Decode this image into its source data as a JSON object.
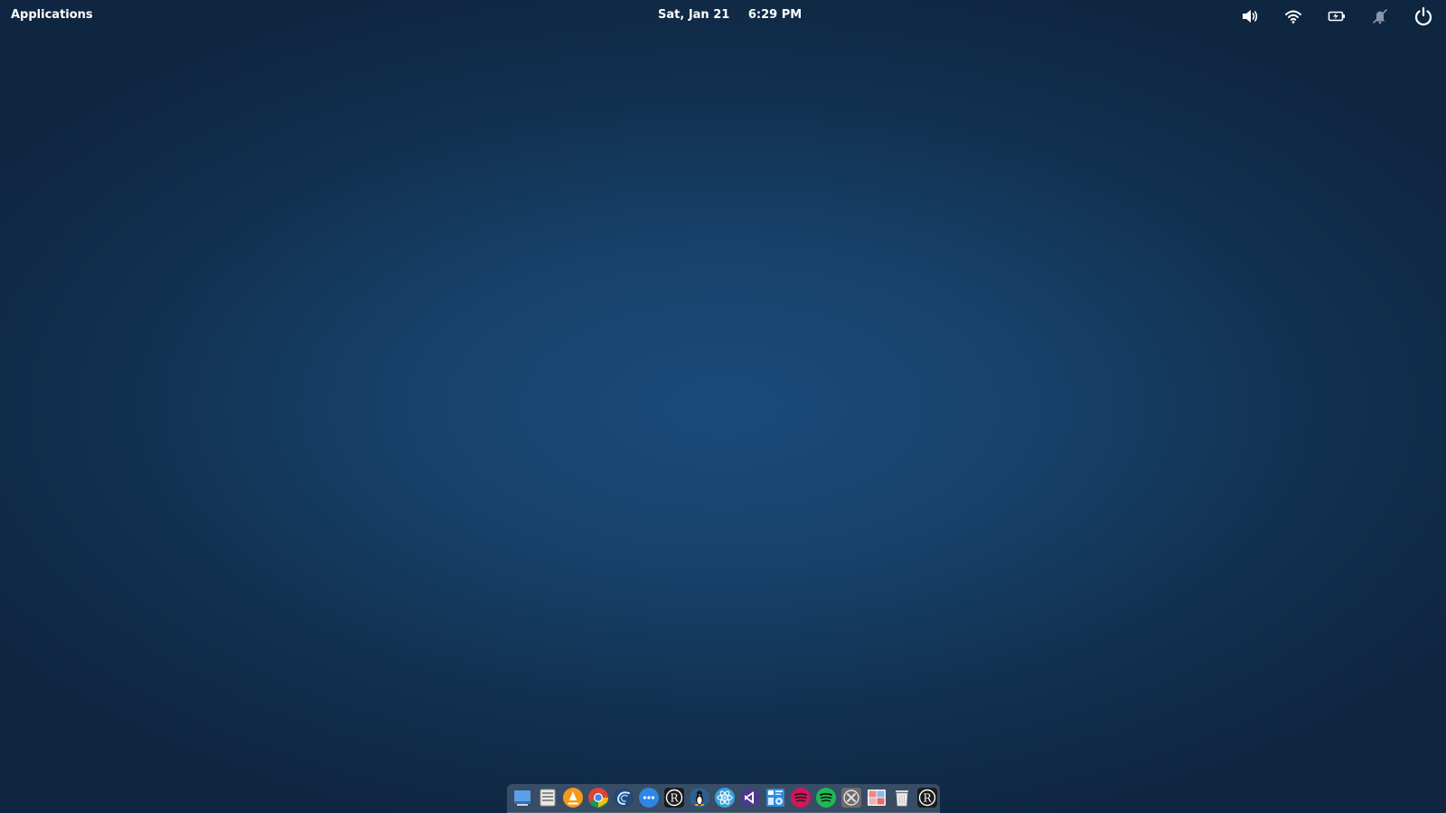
{
  "top_panel": {
    "applications_label": "Applications",
    "date": "Sat, Jan 21",
    "time": "6:29 PM",
    "tray": [
      "volume-icon",
      "wifi-icon",
      "battery-icon",
      "notifications-disabled-icon",
      "power-icon"
    ]
  },
  "colors": {
    "wallpaper_center": "#1a4b7a",
    "wallpaper_edge": "#0f2641",
    "panel_text": "#ffffff"
  },
  "dock": {
    "items": [
      "desktop-icon",
      "file-manager-icon",
      "vlc-icon",
      "chrome-icon",
      "browser-icon",
      "messaging-icon",
      "rstudio-icon",
      "linux-app-icon",
      "atom-icon",
      "visual-studio-icon",
      "settings-app-icon",
      "music-app-icon",
      "spotify-icon",
      "close-app-icon",
      "photos-icon",
      "trash-icon",
      "rstudio-icon-2"
    ]
  }
}
